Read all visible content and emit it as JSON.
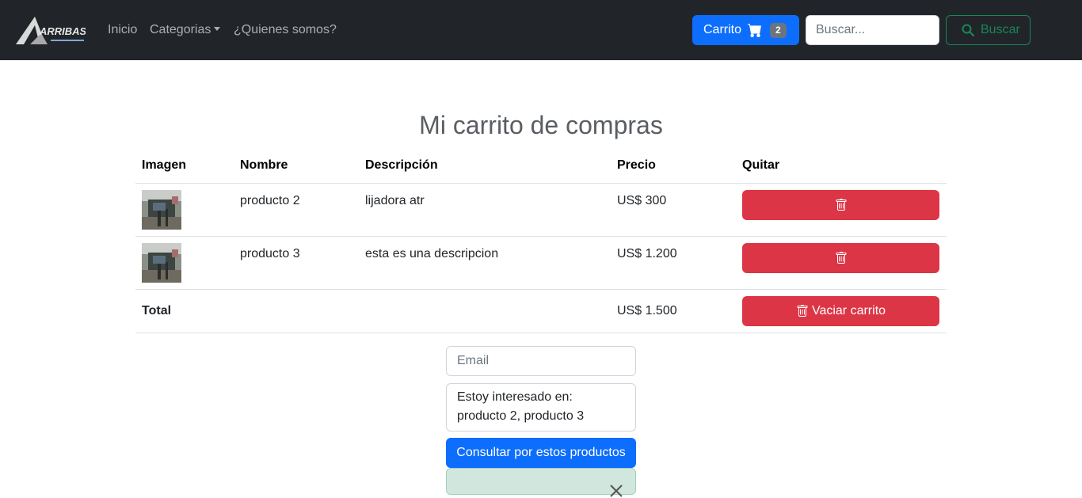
{
  "navbar": {
    "brand_text": "ARRIBAS",
    "links": [
      "Inicio",
      "Categorias",
      "¿Quienes somos?"
    ],
    "cart_label": "Carrito",
    "cart_count": "2",
    "search_placeholder": "Buscar...",
    "search_button": "Buscar"
  },
  "main": {
    "title": "Mi carrito de compras",
    "columns": [
      "Imagen",
      "Nombre",
      "Descripción",
      "Precio",
      "Quitar"
    ],
    "rows": [
      {
        "nombre": "producto 2",
        "descripcion": "lijadora atr",
        "precio": "US$ 300"
      },
      {
        "nombre": "producto 3",
        "descripcion": "esta es una descripcion",
        "precio": "US$ 1.200"
      }
    ],
    "total_label": "Total",
    "total_value": "US$ 1.500",
    "empty_cart_label": "Vaciar carrito"
  },
  "form": {
    "email_placeholder": "Email",
    "message": "Estoy interesado en: producto 2, producto 3",
    "submit_label": "Consultar por estos productos"
  },
  "colors": {
    "navbar": "#212529",
    "primary": "#0d6efd",
    "danger": "#dc3545",
    "success": "#198754",
    "alert_bg": "#d1e7dd"
  },
  "icons": [
    "logo",
    "cart-icon",
    "search-icon",
    "trash-icon",
    "close-icon"
  ]
}
